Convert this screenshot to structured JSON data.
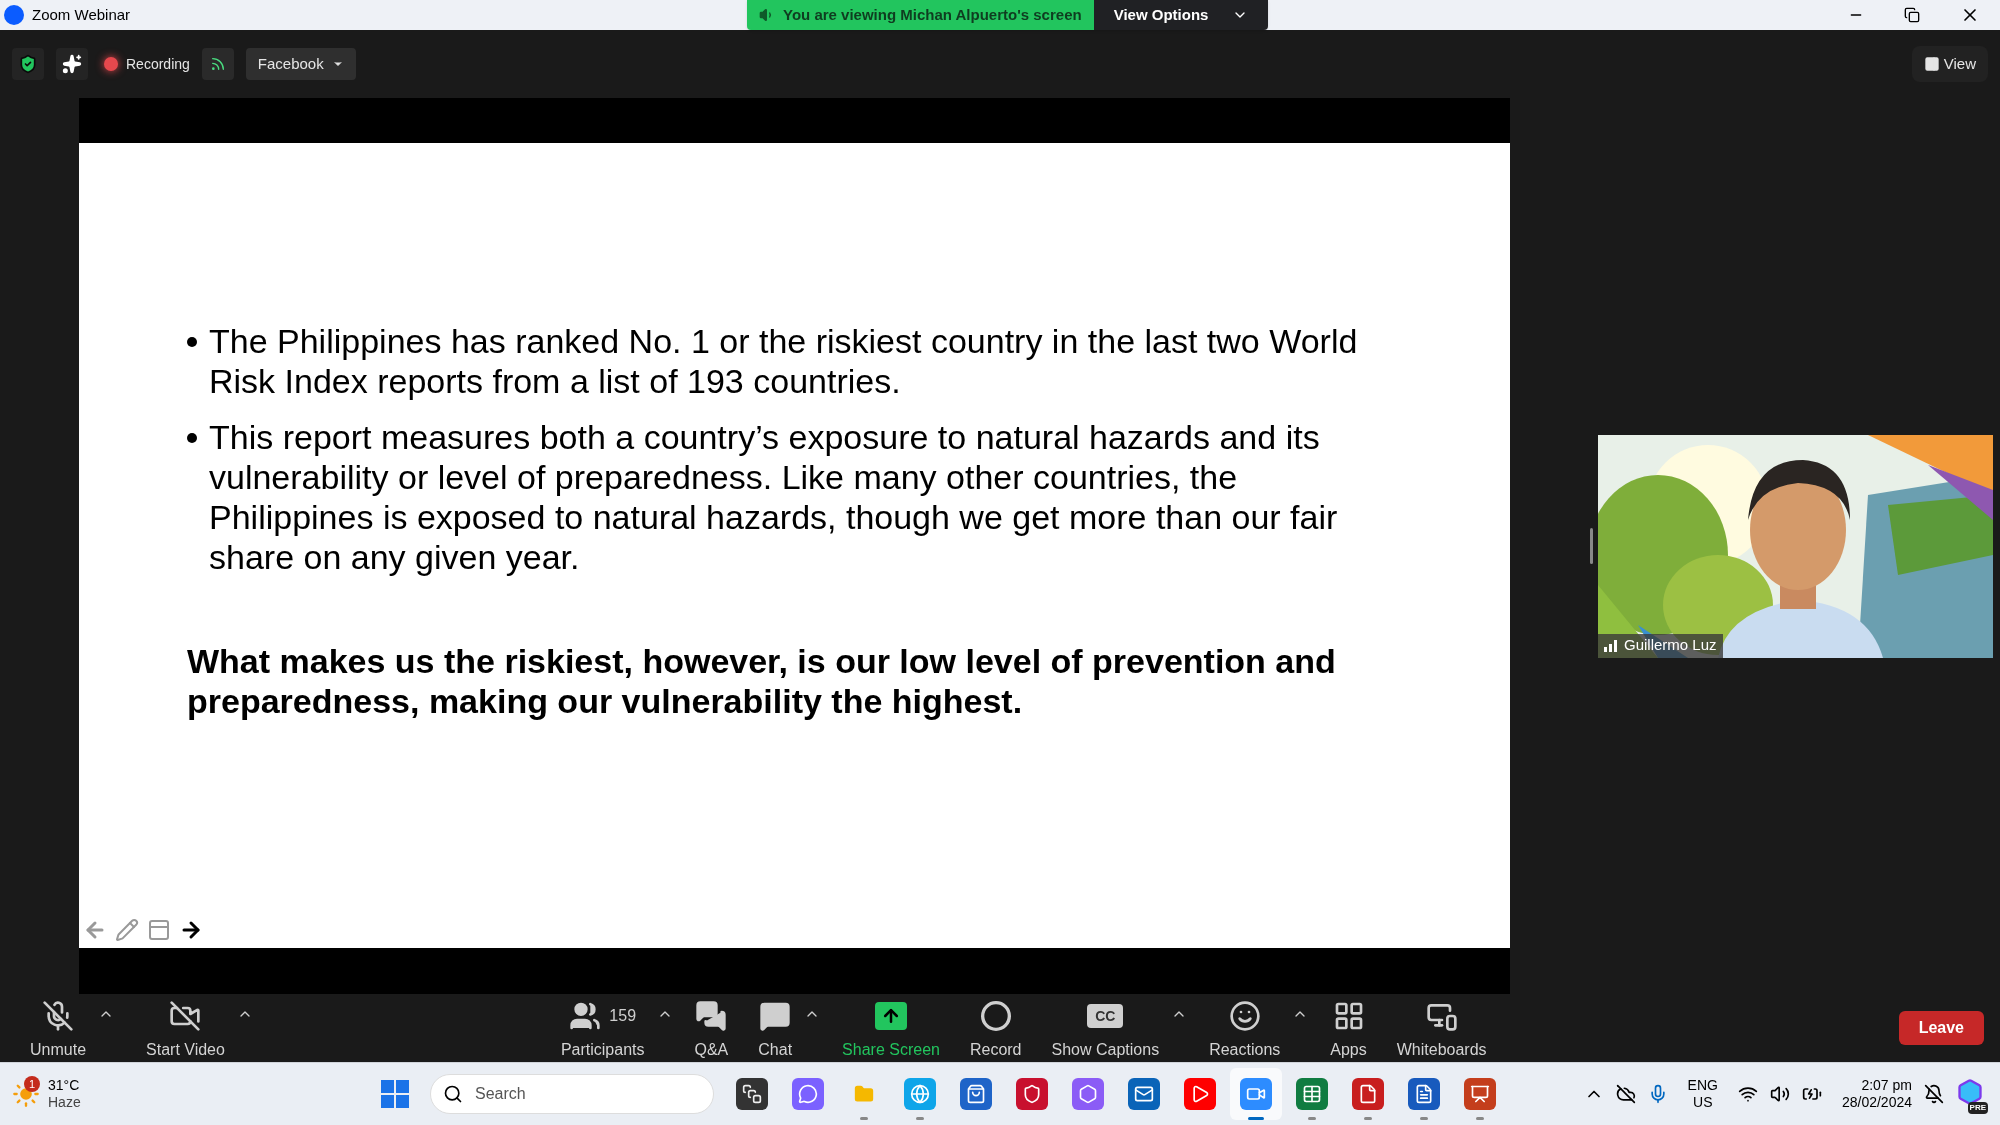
{
  "window": {
    "title": "Zoom Webinar"
  },
  "banner": {
    "text": "You are viewing Michan Alpuerto's screen",
    "button": "View Options"
  },
  "toolbar": {
    "recording": "Recording",
    "stream": "Facebook",
    "view": "View"
  },
  "slide": {
    "bullets": [
      "The Philippines has ranked No. 1 or the riskiest country in the last two World Risk Index reports from a list of 193 countries.",
      "This report measures both a country’s exposure to natural hazards and its vulnerability or level of preparedness. Like many other countries, the Philippines is exposed to natural hazards, though we get more than our fair share on any given year."
    ],
    "statement": "What makes us the riskiest, however, is our low level of prevention and preparedness, making our vulnerability the highest."
  },
  "video": {
    "kind": "picture",
    "name": "Guillermo Luz"
  },
  "controls_left": [
    {
      "kind": "mic",
      "label": "Unmute",
      "caret": true
    },
    {
      "kind": "video",
      "label": "Start Video",
      "caret": true
    }
  ],
  "controls_center": [
    {
      "kind": "participants",
      "label": "Participants",
      "count": "159",
      "caret": true
    },
    {
      "kind": "qa",
      "label": "Q&A",
      "caret": false
    },
    {
      "kind": "chat",
      "label": "Chat",
      "caret": true
    },
    {
      "kind": "share",
      "label": "Share Screen",
      "caret": false
    },
    {
      "kind": "record",
      "label": "Record",
      "caret": false
    },
    {
      "kind": "captions",
      "label": "Show Captions",
      "badge": "CC",
      "caret": true
    },
    {
      "kind": "reactions",
      "label": "Reactions",
      "caret": true
    },
    {
      "kind": "apps",
      "label": "Apps",
      "caret": false
    },
    {
      "kind": "whiteboards",
      "label": "Whiteboards",
      "caret": false
    }
  ],
  "leave": "Leave",
  "taskbar": {
    "weather": {
      "alerts": "1",
      "temp": "31°C",
      "condition": "Haze"
    },
    "search": {
      "placeholder": "Search"
    },
    "apps": [
      {
        "kind": "task-view",
        "running": false,
        "selected": false
      },
      {
        "kind": "chat",
        "running": false,
        "selected": false
      },
      {
        "kind": "folder",
        "running": true,
        "selected": false
      },
      {
        "kind": "browser",
        "running": true,
        "selected": false
      },
      {
        "kind": "store",
        "running": false,
        "selected": false
      },
      {
        "kind": "shield",
        "running": false,
        "selected": false
      },
      {
        "kind": "copilot",
        "running": false,
        "selected": false
      },
      {
        "kind": "mail",
        "running": false,
        "selected": false
      },
      {
        "kind": "play",
        "running": false,
        "selected": false
      },
      {
        "kind": "camera",
        "running": true,
        "selected": true
      },
      {
        "kind": "sheet",
        "running": true,
        "selected": false
      },
      {
        "kind": "pdf",
        "running": true,
        "selected": false
      },
      {
        "kind": "doc",
        "running": true,
        "selected": false
      },
      {
        "kind": "slides",
        "running": true,
        "selected": false
      }
    ],
    "language": "ENG",
    "region": "US",
    "time": "2:07 pm",
    "date": "28/02/2024",
    "assistant_badge": "PRE"
  }
}
